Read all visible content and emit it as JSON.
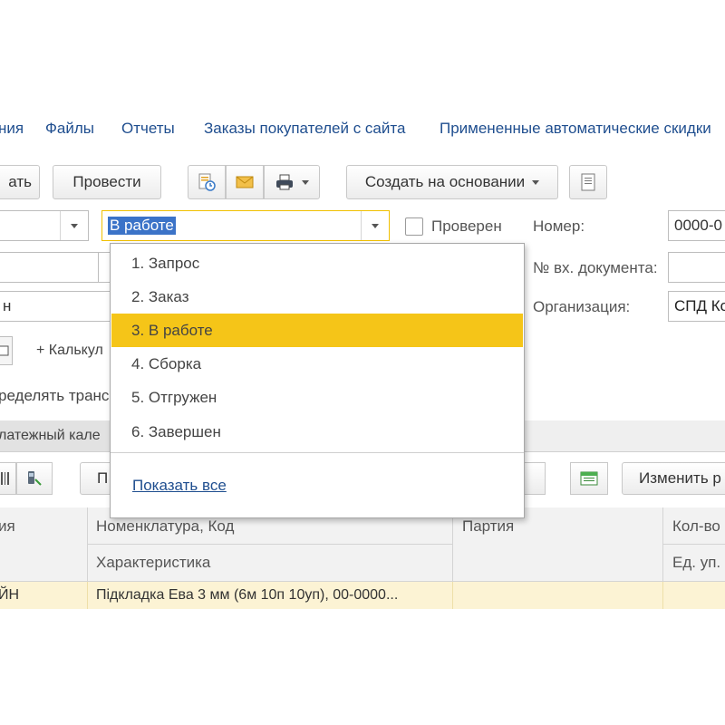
{
  "nav": {
    "links": [
      "ния",
      "Файлы",
      "Отчеты",
      "Заказы покупателей с сайта",
      "Примененные автоматические скидки"
    ]
  },
  "toolbar": {
    "write_label": "ать",
    "post_label": "Провести",
    "create_based_label": "Создать на основании"
  },
  "form": {
    "status_value": "В работе",
    "checked_label": "Проверен",
    "number_label": "Номер:",
    "number_value": "0000-0",
    "incoming_doc_label": "№ вх. документа:",
    "organization_label": "Организация:",
    "organization_value": "СПД Ко",
    "left_field_value": "н",
    "calc_label": "+ Калькул",
    "distribute_label": "ределять транс",
    "tab_label": "латежный кале"
  },
  "dropdown": {
    "options": [
      "1. Запрос",
      "2. Заказ",
      "3. В работе",
      "4. Сборка",
      "5. Отгружен",
      "6. Завершен"
    ],
    "selected_index": 2,
    "show_all_label": "Показать все"
  },
  "table_toolbar": {
    "left_btn_label": "П",
    "change_label": "Изменить р"
  },
  "table": {
    "headers": {
      "col0": "ия",
      "nomenclature": "Номенклатура, Код",
      "characteristic": "Характеристика",
      "batch": "Партия",
      "qty": "Кол-во",
      "unit": "Ед. уп."
    },
    "row": {
      "col0": "ЙН",
      "nomenclature": "Підкладка Ева 3 мм (6м 10п 10уп), 00-0000..."
    }
  },
  "colors": {
    "link": "#1f4e8f",
    "selected_option": "#f5c518",
    "row_highlight": "#fcf3d4",
    "focus_border": "#f0c000"
  }
}
